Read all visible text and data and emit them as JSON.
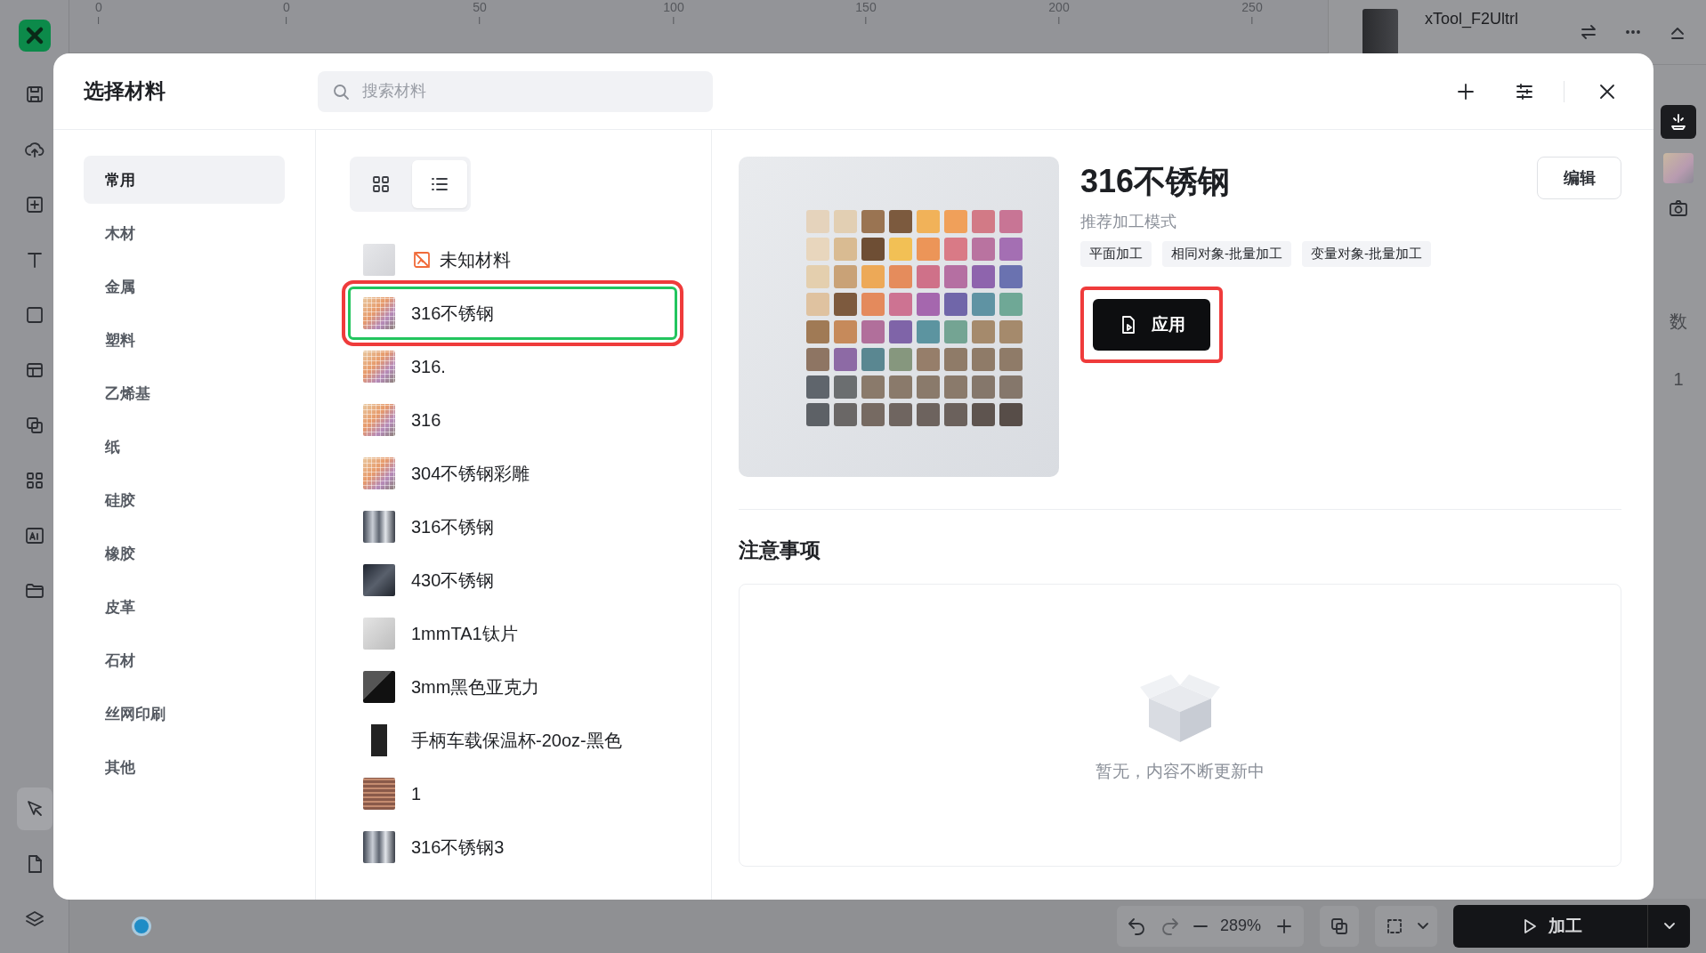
{
  "app": {
    "tools": [
      {
        "kind": "save",
        "selected": false
      },
      {
        "kind": "upload",
        "selected": false
      },
      {
        "kind": "add",
        "selected": false
      },
      {
        "kind": "text",
        "selected": false
      },
      {
        "kind": "shape",
        "selected": false
      },
      {
        "kind": "layout",
        "selected": false
      },
      {
        "kind": "copy",
        "selected": false
      },
      {
        "kind": "apps",
        "selected": false
      },
      {
        "kind": "ai",
        "selected": false
      },
      {
        "kind": "folder",
        "selected": false
      }
    ],
    "bottom_tools": [
      {
        "kind": "pen",
        "selected": true
      },
      {
        "kind": "file",
        "selected": false
      },
      {
        "kind": "layers",
        "selected": false
      }
    ],
    "ruler_labels": [
      "0",
      "0",
      "50",
      "100",
      "150",
      "200",
      "250"
    ],
    "device": {
      "name": "xTool_F2Ultrl"
    },
    "panel_label": "数",
    "panel_value": "1",
    "zoom": "289%",
    "process_button": "加工"
  },
  "dialog": {
    "title": "选择材料",
    "search": {
      "placeholder": "搜索材料"
    },
    "categories": [
      {
        "label": "常用",
        "selected": true
      },
      {
        "label": "木材",
        "selected": false
      },
      {
        "label": "金属",
        "selected": false
      },
      {
        "label": "塑料",
        "selected": false
      },
      {
        "label": "乙烯基",
        "selected": false
      },
      {
        "label": "纸",
        "selected": false
      },
      {
        "label": "硅胶",
        "selected": false
      },
      {
        "label": "橡胶",
        "selected": false
      },
      {
        "label": "皮革",
        "selected": false
      },
      {
        "label": "石材",
        "selected": false
      },
      {
        "label": "丝网印刷",
        "selected": false
      },
      {
        "label": "其他",
        "selected": false
      }
    ],
    "view_modes": [
      {
        "kind": "grid",
        "selected": false
      },
      {
        "kind": "list",
        "selected": true
      }
    ],
    "materials": [
      {
        "name": "未知材料",
        "kind": "unknown",
        "selected": false,
        "highlighted": false
      },
      {
        "name": "316不锈钢",
        "kind": "chart",
        "selected": true,
        "highlighted": true
      },
      {
        "name": "316.",
        "kind": "chart",
        "selected": false,
        "highlighted": false
      },
      {
        "name": "316",
        "kind": "chart",
        "selected": false,
        "highlighted": false
      },
      {
        "name": "304不锈钢彩雕",
        "kind": "chart",
        "selected": false,
        "highlighted": false
      },
      {
        "name": "316不锈钢",
        "kind": "metal",
        "selected": false,
        "highlighted": false
      },
      {
        "name": "430不锈钢",
        "kind": "dark",
        "selected": false,
        "highlighted": false
      },
      {
        "name": "1mmTA1钛片",
        "kind": "light",
        "selected": false,
        "highlighted": false
      },
      {
        "name": "3mm黑色亚克力",
        "kind": "black",
        "selected": false,
        "highlighted": false
      },
      {
        "name": "手柄车载保温杯-20oz-黑色",
        "kind": "tumbler",
        "selected": false,
        "highlighted": false
      },
      {
        "name": "1",
        "kind": "copper",
        "selected": false,
        "highlighted": false
      },
      {
        "name": "316不锈钢3",
        "kind": "metal",
        "selected": false,
        "highlighted": false
      }
    ],
    "detail": {
      "title": "316不锈钢",
      "edit_button": "编辑",
      "modes_label": "推荐加工模式",
      "modes": [
        "平面加工",
        "相同对象-批量加工",
        "变量对象-批量加工"
      ],
      "apply_button": {
        "label": "应用",
        "highlighted": true
      },
      "notes_title": "注意事项",
      "empty_text": "暂无，内容不断更新中"
    }
  }
}
